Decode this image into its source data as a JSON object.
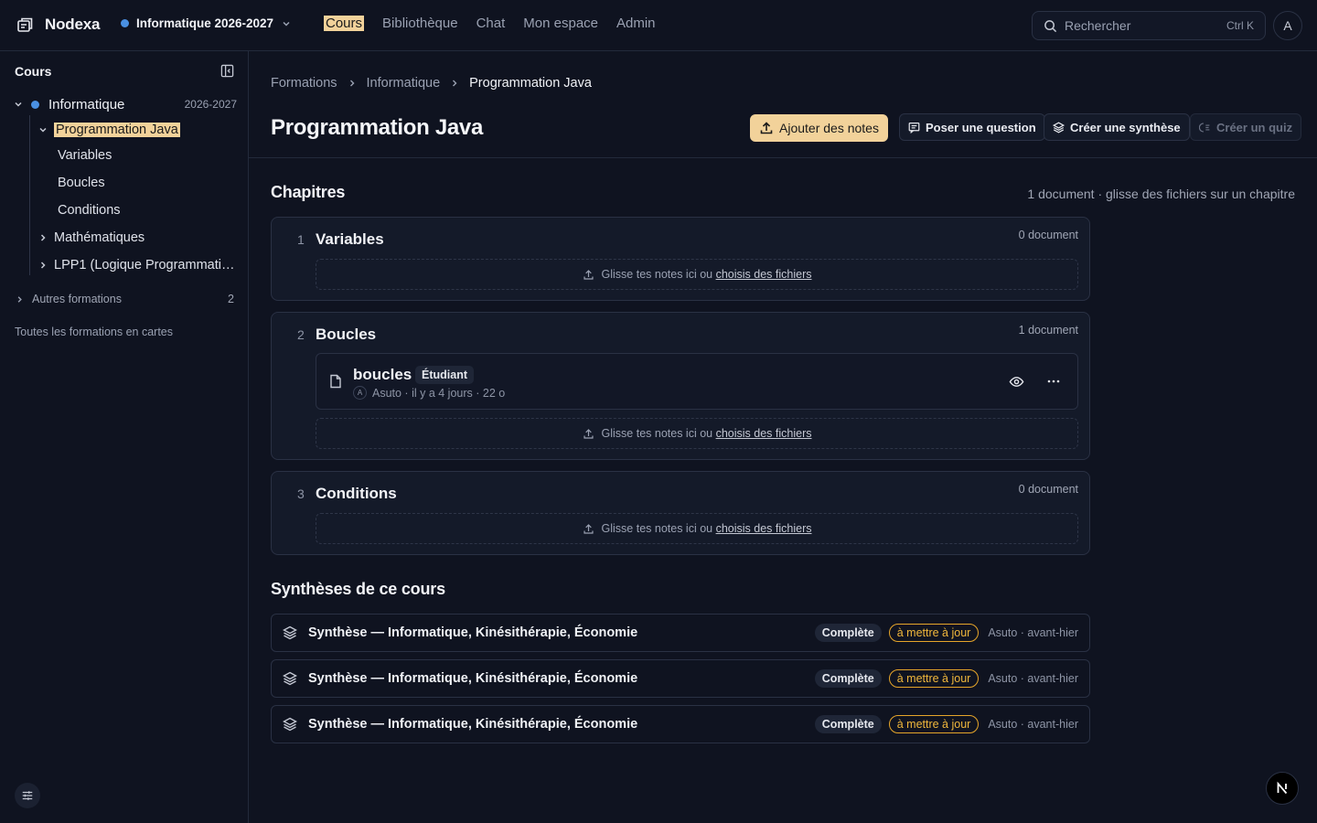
{
  "brand": {
    "name": "Nodexa"
  },
  "workspace": {
    "label": "Informatique 2026-2027"
  },
  "nav": {
    "items": [
      "Cours",
      "Bibliothèque",
      "Chat",
      "Mon espace",
      "Admin"
    ],
    "active": "Cours"
  },
  "search": {
    "placeholder": "Rechercher",
    "shortcut": "Ctrl K"
  },
  "user": {
    "initial": "A"
  },
  "sidebar": {
    "title": "Cours",
    "root": {
      "label": "Informatique",
      "year": "2026-2027"
    },
    "course": {
      "label": "Programmation Java"
    },
    "chapters": [
      "Variables",
      "Boucles",
      "Conditions"
    ],
    "siblings": [
      "Mathématiques",
      "LPP1 (Logique Programmati…"
    ],
    "others": {
      "label": "Autres formations",
      "count": "2"
    },
    "all_cards": "Toutes les formations en cartes"
  },
  "breadcrumb": [
    "Formations",
    "Informatique",
    "Programmation Java"
  ],
  "page": {
    "title": "Programmation Java"
  },
  "actions": {
    "add_notes": "Ajouter des notes",
    "ask": "Poser une question",
    "synthesis": "Créer une synthèse",
    "quiz": "Créer un quiz"
  },
  "chapters_section": {
    "title": "Chapitres",
    "meta": "1 document · glisse des fichiers sur un chapitre",
    "drop_text": "Glisse tes notes ici ou ",
    "drop_link": "choisis des fichiers",
    "items": [
      {
        "num": "1",
        "name": "Variables",
        "count": "0 document"
      },
      {
        "num": "2",
        "name": "Boucles",
        "count": "1 document",
        "doc": {
          "name": "boucles",
          "badge": "Étudiant",
          "author_initial": "A",
          "meta": "Asuto · il y a 4 jours · 22 o"
        }
      },
      {
        "num": "3",
        "name": "Conditions",
        "count": "0 document"
      }
    ]
  },
  "syntheses": {
    "title": "Synthèses de ce cours",
    "items": [
      {
        "title": "Synthèse — Informatique, Kinésithérapie, Économie",
        "status": "Complète",
        "flag": "à mettre à jour",
        "meta": "Asuto · avant-hier"
      },
      {
        "title": "Synthèse — Informatique, Kinésithérapie, Économie",
        "status": "Complète",
        "flag": "à mettre à jour",
        "meta": "Asuto · avant-hier"
      },
      {
        "title": "Synthèse — Informatique, Kinésithérapie, Économie",
        "status": "Complète",
        "flag": "à mettre à jour",
        "meta": "Asuto · avant-hier"
      }
    ]
  },
  "colors": {
    "accent": "#f2d29a",
    "warning": "#f0b73c",
    "dot": "#4a90e2",
    "bg": "#0f1320"
  }
}
